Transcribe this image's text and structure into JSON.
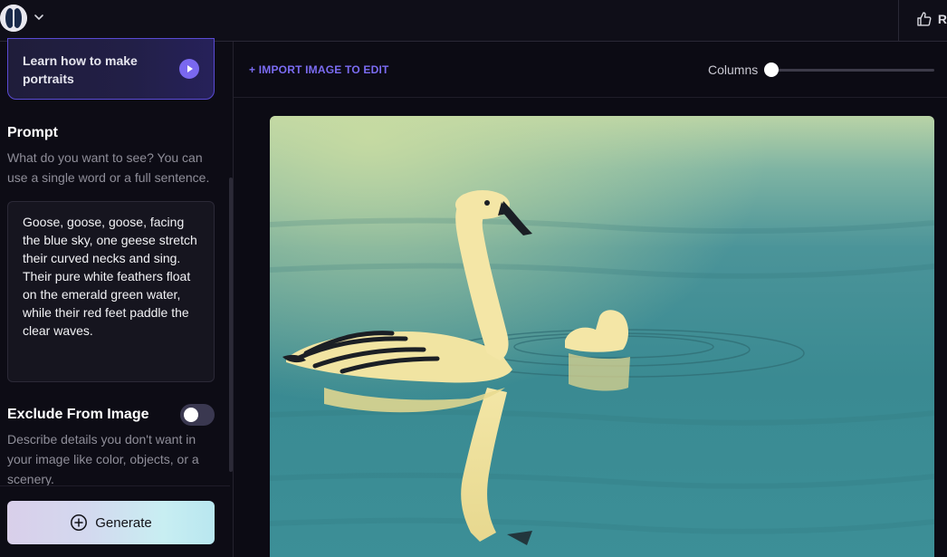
{
  "topbar": {
    "logo_icon": "split-circle-logo-icon",
    "chevron_icon": "chevron-down-icon",
    "thumb_icon": "thumbs-up-icon",
    "thumb_label": "R"
  },
  "sidebar": {
    "learn_card": {
      "label": "Learn how to make portraits",
      "play_icon": "play-icon"
    },
    "prompt": {
      "title": "Prompt",
      "description": "What do you want to see? You can use a single word or a full sentence.",
      "value": "Goose, goose, goose, facing the blue sky, one geese stretch their curved necks and sing. Their pure white feathers float on the emerald green water, while their red feet paddle the clear waves."
    },
    "exclude": {
      "title": "Exclude From Image",
      "enabled": false,
      "description": "Describe details you don't want in your image like color, objects, or a scenery."
    },
    "generate": {
      "label": "Generate",
      "icon": "plus-circle-icon"
    }
  },
  "main": {
    "import_label": "+ IMPORT IMAGE TO EDIT",
    "columns_label": "Columns",
    "columns_value": 0
  },
  "colors": {
    "accent": "#7b6cf2",
    "background": "#0d0c15",
    "water": "#3f8e95"
  }
}
